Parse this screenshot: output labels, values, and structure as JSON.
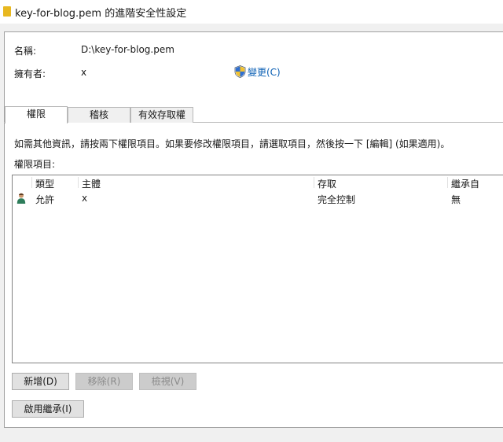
{
  "window": {
    "title": "key-for-blog.pem 的進階安全性設定"
  },
  "owner_section": {
    "name_label": "名稱:",
    "name_value": "D:\\key-for-blog.pem",
    "owner_label": "擁有者:",
    "owner_value": "x",
    "change_link": "變更(C)"
  },
  "tabs": [
    {
      "label": "權限"
    },
    {
      "label": "稽核"
    },
    {
      "label": "有效存取權"
    }
  ],
  "info_text": "如需其他資訊，請按兩下權限項目。如果要修改權限項目，請選取項目，然後按一下 [編輯] (如果適用)。",
  "entries_label": "權限項目:",
  "table": {
    "columns": [
      "類型",
      "主體",
      "存取",
      "繼承自"
    ],
    "rows": [
      {
        "type": "允許",
        "principal": "x",
        "access": "完全控制",
        "inherited": "無"
      }
    ]
  },
  "buttons": {
    "add": "新增(D)",
    "remove": "移除(R)",
    "view": "檢視(V)",
    "enable_inheritance": "啟用繼承(I)"
  },
  "colors": {
    "link": "#0a5fb4",
    "folder_icon": "#e8b820"
  }
}
